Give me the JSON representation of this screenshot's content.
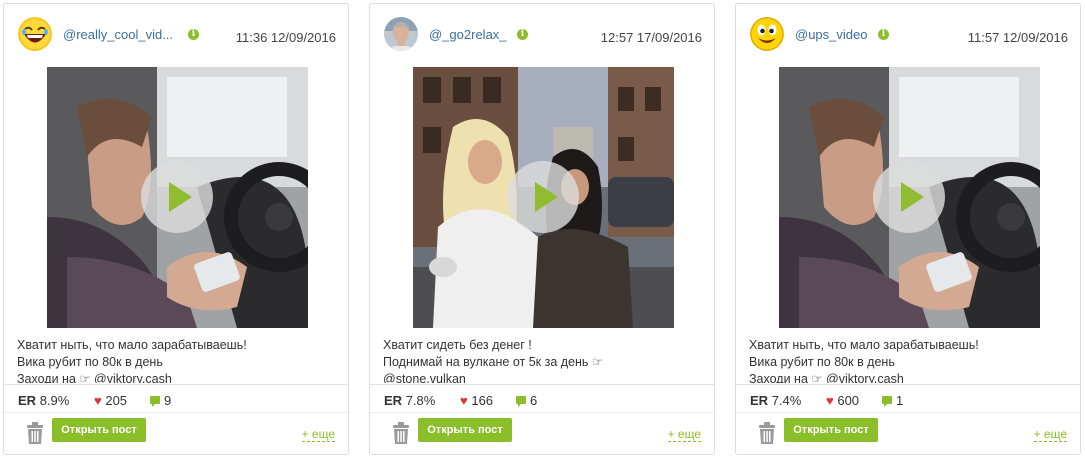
{
  "cards": [
    {
      "avatar": "laughing-emoji-avatar",
      "username": "@really_cool_vid...",
      "info_glyph": "i",
      "timestamp": "11:36 12/09/2016",
      "caption": [
        "Хватит ныть, что мало зарабатываешь!",
        "Вика рубит по 80к в день",
        "Заходи на ☞ @viktory.cash"
      ],
      "er_label": "ER",
      "er_value": "8.9%",
      "likes": "205",
      "comments": "9",
      "open_label": "Открыть пост",
      "more_label": "+ еще"
    },
    {
      "avatar": "man-photo-avatar",
      "username": "@_go2relax_",
      "info_glyph": "i",
      "timestamp": "12:57 17/09/2016",
      "caption": [
        "Хватит сидеть без денег !",
        "Поднимай на вулкане от 5к за день ☞",
        "@stone.vulkan"
      ],
      "er_label": "ER",
      "er_value": "7.8%",
      "likes": "166",
      "comments": "6",
      "open_label": "Открыть пост",
      "more_label": "+ еще"
    },
    {
      "avatar": "smiley-emoji-avatar",
      "username": "@ups_video",
      "info_glyph": "i",
      "timestamp": "11:57 12/09/2016",
      "caption": [
        "Хватит ныть, что мало зарабатываешь!",
        "Вика рубит по 80к в день",
        "Заходи на ☞ @viktory.cash"
      ],
      "er_label": "ER",
      "er_value": "7.4%",
      "likes": "600",
      "comments": "1",
      "open_label": "Открыть пост",
      "more_label": "+ еще"
    }
  ],
  "icons": {
    "heart": "♥",
    "trash": "trash-icon",
    "play": "play-icon",
    "comment": "comment-icon"
  },
  "colors": {
    "accent_green": "#8bbf2a",
    "username_blue": "#3c6f99",
    "heart_red": "#d9383a"
  }
}
